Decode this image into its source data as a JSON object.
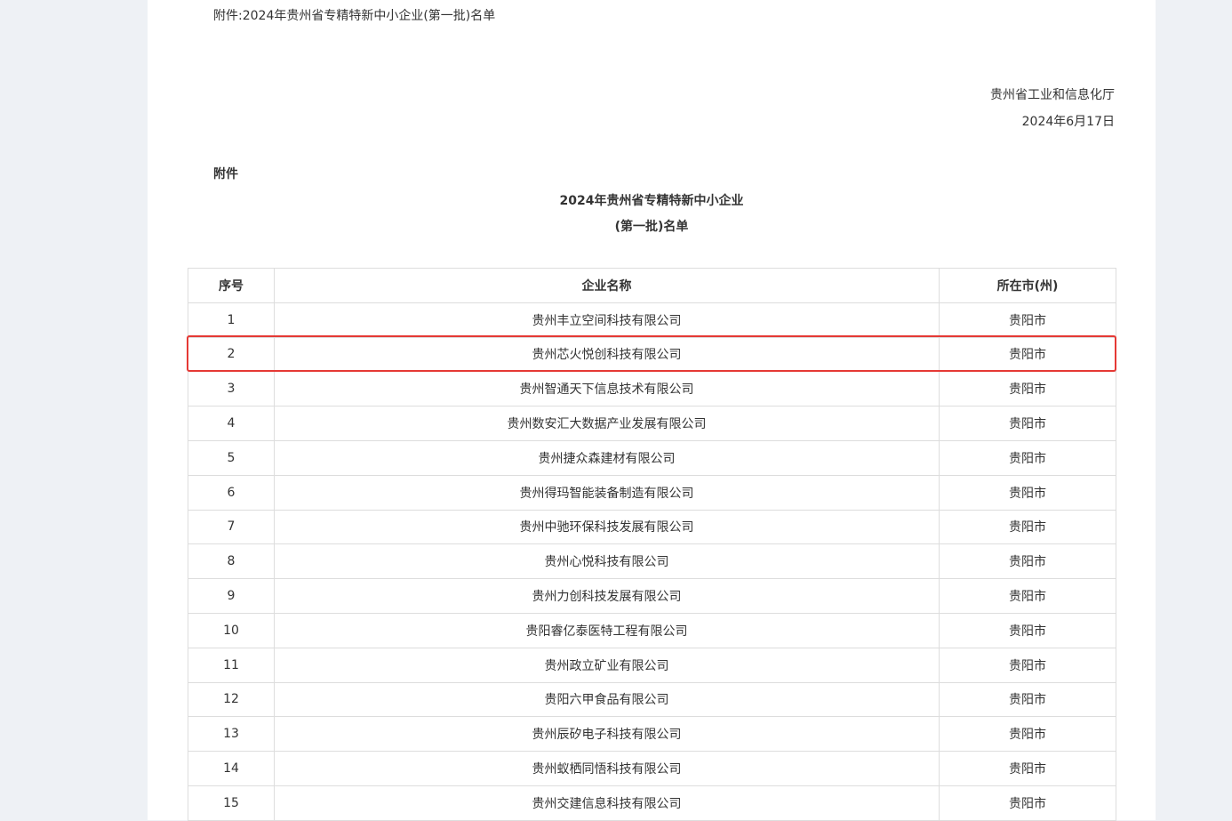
{
  "attachment_link": "附件:2024年贵州省专精特新中小企业(第一批)名单",
  "issuer": "贵州省工业和信息化厅",
  "issue_date": "2024年6月17日",
  "attachment_label": "附件",
  "title_line1": "2024年贵州省专精特新中小企业",
  "title_line2": "(第一批)名单",
  "table": {
    "headers": [
      "序号",
      "企业名称",
      "所在市(州)"
    ],
    "rows": [
      [
        "1",
        "贵州丰立空间科技有限公司",
        "贵阳市"
      ],
      [
        "2",
        "贵州芯火悦创科技有限公司",
        "贵阳市"
      ],
      [
        "3",
        "贵州智通天下信息技术有限公司",
        "贵阳市"
      ],
      [
        "4",
        "贵州数安汇大数据产业发展有限公司",
        "贵阳市"
      ],
      [
        "5",
        "贵州捷众森建材有限公司",
        "贵阳市"
      ],
      [
        "6",
        "贵州得玛智能装备制造有限公司",
        "贵阳市"
      ],
      [
        "7",
        "贵州中驰环保科技发展有限公司",
        "贵阳市"
      ],
      [
        "8",
        "贵州心悦科技有限公司",
        "贵阳市"
      ],
      [
        "9",
        "贵州力创科技发展有限公司",
        "贵阳市"
      ],
      [
        "10",
        "贵阳睿亿泰医特工程有限公司",
        "贵阳市"
      ],
      [
        "11",
        "贵州政立矿业有限公司",
        "贵阳市"
      ],
      [
        "12",
        "贵阳六甲食品有限公司",
        "贵阳市"
      ],
      [
        "13",
        "贵州辰矽电子科技有限公司",
        "贵阳市"
      ],
      [
        "14",
        "贵州蚁栖同悟科技有限公司",
        "贵阳市"
      ],
      [
        "15",
        "贵州交建信息科技有限公司",
        "贵阳市"
      ]
    ]
  },
  "colors": {
    "highlight": "#e53935",
    "background": "#eef1f5",
    "border": "#dddddd"
  }
}
